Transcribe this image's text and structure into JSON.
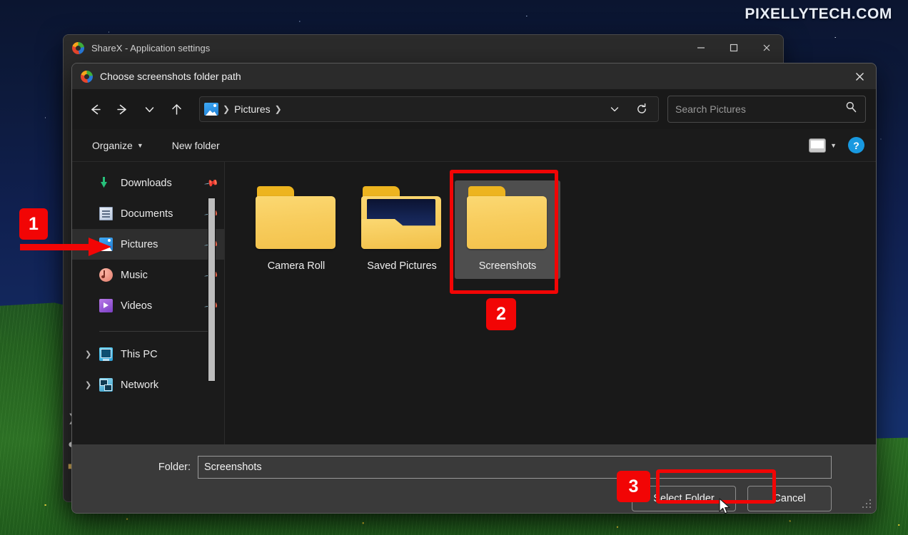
{
  "watermark": "PIXELLYTECH.COM",
  "background_window": {
    "title": "ShareX - Application settings",
    "logo_icon": "sharex-logo-icon",
    "controls": [
      {
        "name": "minimize-button",
        "glyph": "minimize-icon"
      },
      {
        "name": "maximize-button",
        "glyph": "maximize-icon"
      },
      {
        "name": "close-button",
        "glyph": "close-icon"
      }
    ]
  },
  "dialog": {
    "title": "Choose screenshots folder path",
    "logo_icon": "sharex-logo-icon",
    "close_icon": "close-icon",
    "nav": {
      "back_icon": "arrow-left-icon",
      "forward_icon": "arrow-right-icon",
      "recent_icon": "chevron-down-icon",
      "up_icon": "arrow-up-icon",
      "breadcrumb_icon": "pictures-folder-icon",
      "breadcrumb": [
        "Pictures"
      ],
      "address_dropdown_icon": "chevron-down-icon",
      "refresh_icon": "refresh-icon",
      "search_placeholder": "Search Pictures",
      "search_value": "",
      "search_icon": "search-icon"
    },
    "toolbar": {
      "organize_label": "Organize",
      "organize_caret_icon": "caret-down-icon",
      "new_folder_label": "New folder",
      "view_icon": "view-layout-icon",
      "view_caret_icon": "caret-down-icon",
      "help_label": "?",
      "help_icon": "help-icon"
    },
    "nav_pane": {
      "items": [
        {
          "label": "Downloads",
          "icon": "downloads-icon",
          "pinned": true,
          "selected": false,
          "expandable": false
        },
        {
          "label": "Documents",
          "icon": "documents-icon",
          "pinned": true,
          "selected": false,
          "expandable": false
        },
        {
          "label": "Pictures",
          "icon": "pictures-icon",
          "pinned": true,
          "selected": true,
          "expandable": false
        },
        {
          "label": "Music",
          "icon": "music-icon",
          "pinned": true,
          "selected": false,
          "expandable": false
        },
        {
          "label": "Videos",
          "icon": "videos-icon",
          "pinned": true,
          "selected": false,
          "expandable": false
        }
      ],
      "items2": [
        {
          "label": "This PC",
          "icon": "this-pc-icon",
          "pinned": false,
          "selected": false,
          "expandable": true
        },
        {
          "label": "Network",
          "icon": "network-icon",
          "pinned": false,
          "selected": false,
          "expandable": true
        }
      ],
      "pin_icon": "pin-icon",
      "expand_icon": "chevron-right-icon",
      "scrollbar": "vertical-scrollbar"
    },
    "files": [
      {
        "label": "Camera Roll",
        "icon": "folder-icon",
        "selected": false
      },
      {
        "label": "Saved Pictures",
        "icon": "folder-preview-icon",
        "selected": false
      },
      {
        "label": "Screenshots",
        "icon": "folder-icon",
        "selected": true
      }
    ],
    "footer": {
      "folder_label": "Folder:",
      "folder_value": "Screenshots",
      "select_button": "Select Folder",
      "cancel_button": "Cancel",
      "resize_grip": "resize-grip-icon"
    }
  },
  "annotations": {
    "badge_1": "1",
    "badge_2": "2",
    "badge_3": "3",
    "color": "#f20505",
    "arrow": "right-arrow-annotation",
    "highlight_screenshots": "screenshots-folder-highlight",
    "highlight_select": "select-folder-highlight"
  },
  "cursor": "mouse-pointer"
}
